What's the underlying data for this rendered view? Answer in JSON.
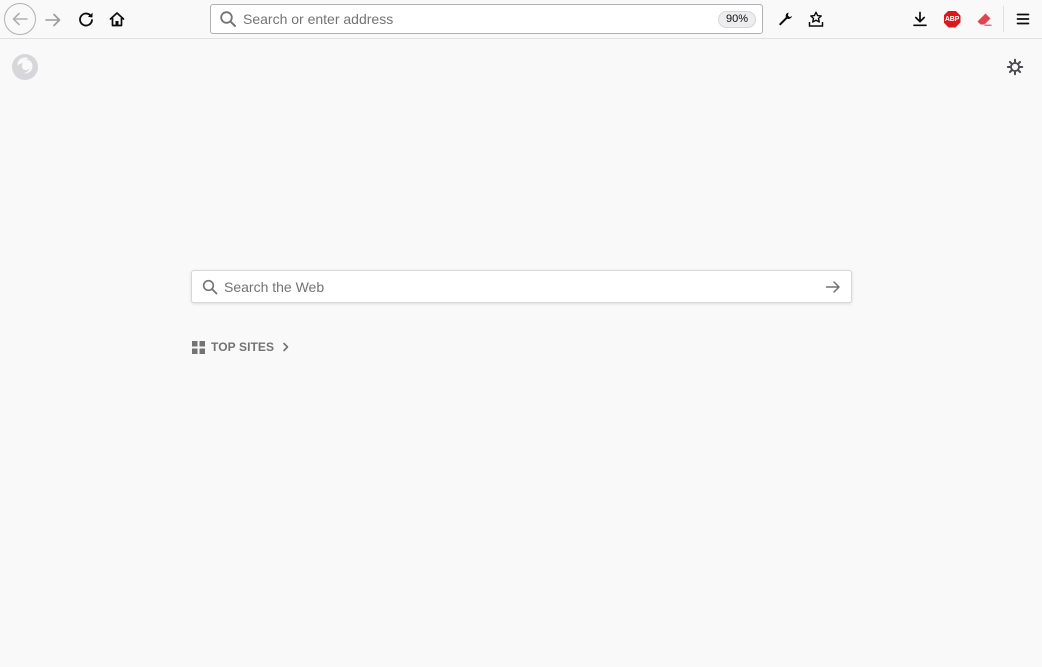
{
  "toolbar": {
    "back": {
      "icon": "back-arrow-icon"
    },
    "forward": {
      "icon": "forward-arrow-icon"
    },
    "reload": {
      "icon": "reload-icon"
    },
    "home": {
      "icon": "home-icon"
    },
    "urlbar": {
      "placeholder": "Search or enter address",
      "value": "",
      "zoom": "90%"
    },
    "right_icons": [
      "wrench-icon",
      "star-inbox-icon",
      "download-icon",
      "adblock-plus-icon",
      "eraser-icon",
      "hamburger-menu-icon"
    ],
    "abp_label": "ABP"
  },
  "newtab": {
    "search": {
      "placeholder": "Search the Web",
      "value": ""
    },
    "top_sites": {
      "label": "TOP SITES"
    }
  },
  "colors": {
    "background": "#f9f9fa",
    "icon": "#0c0c0d",
    "muted": "#737373",
    "abp_red": "#d9191c",
    "eraser_red": "#e04453"
  }
}
